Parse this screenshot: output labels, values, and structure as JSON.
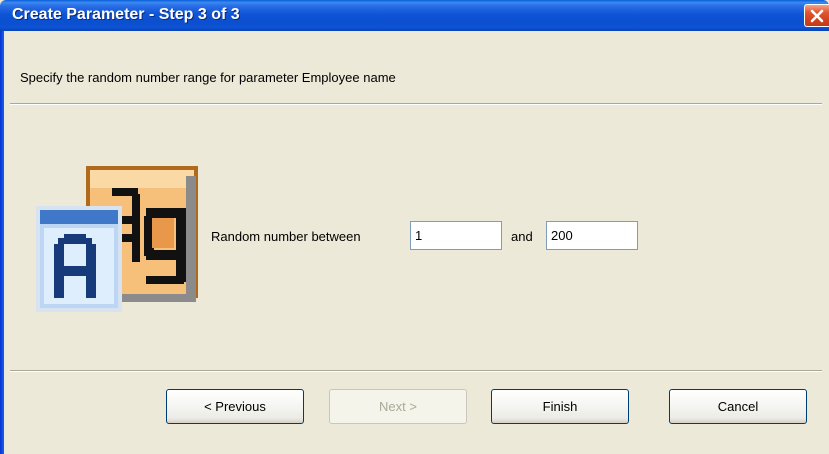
{
  "window": {
    "title": "Create Parameter - Step 3 of 3"
  },
  "header": {
    "instruction": "Specify the random number range for parameter Employee name"
  },
  "range": {
    "label": "Random number between",
    "min_value": "1",
    "and_label": "and",
    "max_value": "200"
  },
  "buttons": {
    "previous": "< Previous",
    "next": "Next >",
    "finish": "Finish",
    "cancel": "Cancel"
  },
  "icons": {
    "close": "close-icon",
    "wizard": "font-glyph-icon"
  },
  "colors": {
    "titlebar": "#0b4fcf",
    "close_button": "#d24320",
    "dialog_background": "#ece9d8"
  }
}
